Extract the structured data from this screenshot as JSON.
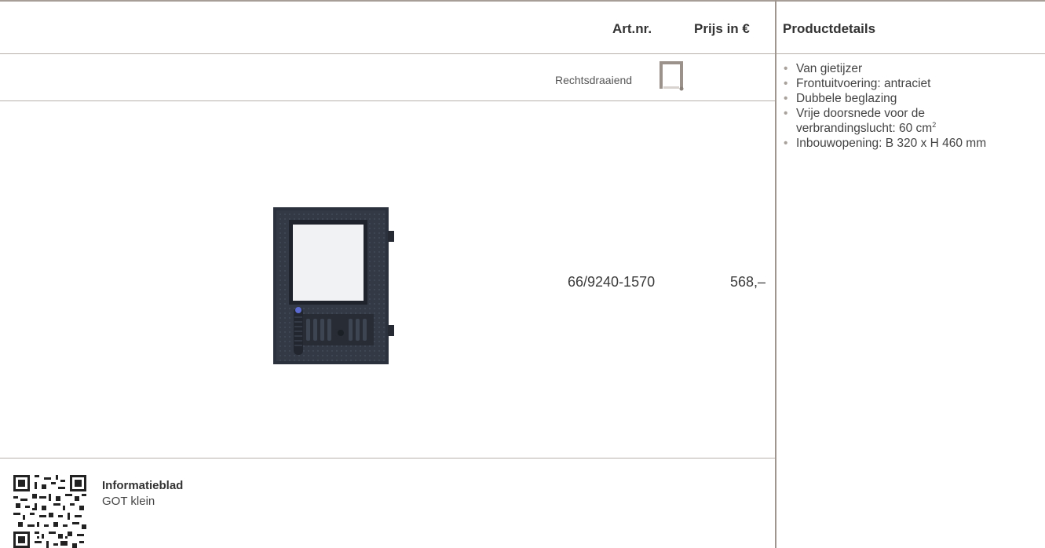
{
  "header": {
    "title_fragment": ", (…)",
    "artnr_label": "Art.nr.",
    "price_label": "Prijs in €",
    "details_label": "Productdetails"
  },
  "variant": {
    "direction_label": "Rechtsdraaiend",
    "direction_icon": "door-right-hinge-icon"
  },
  "product": {
    "image": "cast-iron-stove-door",
    "artnr": "66/9240-1570",
    "price": "568,–"
  },
  "details": {
    "items": [
      "Van gietijzer",
      "Frontuitvoering: antraciet",
      "Dubbele beglazing",
      "Vrije doorsnede voor de verbrandingslucht: 60 cm",
      "Inbouwopening: B 320 x H 460 mm"
    ],
    "item4_line1": "Vrije doorsnede voor de",
    "item4_line2": "verbrandingslucht: 60",
    "item4_unit": "cm",
    "item4_sup": "2"
  },
  "info": {
    "qr": "qr-code",
    "title": "Informatieblad",
    "subtitle": "GOT klein"
  },
  "colors": {
    "border": "#a79e98",
    "door": "#2e3440",
    "text": "#3a3a3a"
  }
}
